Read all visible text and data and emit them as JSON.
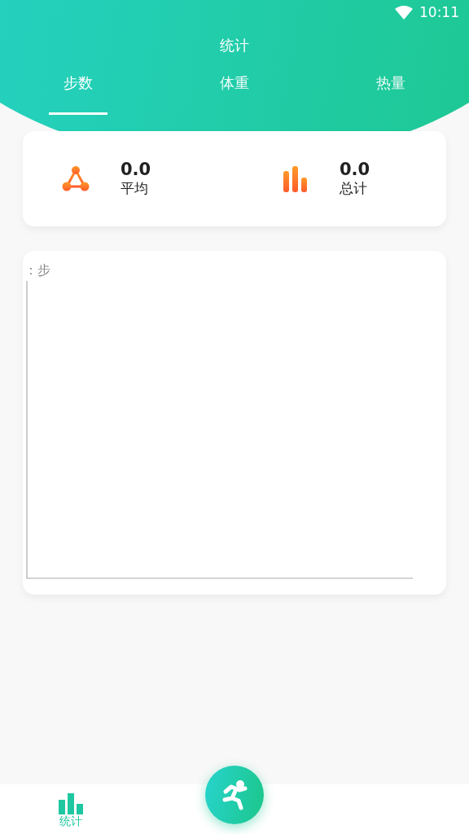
{
  "status_bar": {
    "time": "10:11"
  },
  "header": {
    "title": "统计"
  },
  "tabs": [
    {
      "label": "步数",
      "selected": true
    },
    {
      "label": "体重",
      "selected": false
    },
    {
      "label": "热量",
      "selected": false
    }
  ],
  "summary": [
    {
      "kind": "average",
      "value": "0.0",
      "label": "平均"
    },
    {
      "kind": "total",
      "value": "0.0",
      "label": "总计"
    }
  ],
  "chart": {
    "unit_label": "：步"
  },
  "bottom_nav": [
    {
      "kind": "stats",
      "label": "统计",
      "selected": true
    }
  ],
  "fab": {
    "kind": "run"
  }
}
